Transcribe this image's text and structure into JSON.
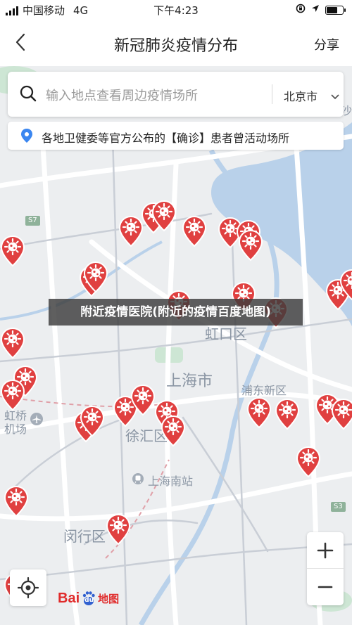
{
  "status_bar": {
    "carrier": "中国移动",
    "network": "4G",
    "time": "下午4:23",
    "battery_level": 0.7
  },
  "nav": {
    "title": "新冠肺炎疫情分布",
    "share_label": "分享"
  },
  "search": {
    "placeholder": "输入地点查看周边疫情场所",
    "city": "北京市"
  },
  "info": {
    "text": "各地卫健委等官方公布的【确诊】患者曾活动场所"
  },
  "map_labels": {
    "hongkou": "虹口区",
    "shanghai": "上海市",
    "pudong": "浦东新区",
    "xujiahui": "徐汇区",
    "minhang": "闵行区",
    "south_station": "上海南站",
    "hongqiao": "虹桥",
    "airport": "机场",
    "s7": "S7",
    "s3": "S3",
    "sha": "沙"
  },
  "caption": "附近疫情医院(附近的疫情百度地图)",
  "zoom": {
    "in": "+",
    "out": "−"
  },
  "logo": {
    "bai": "Bai",
    "du": "du",
    "map": "地图"
  },
  "icons": {
    "back": "chevron-left-icon",
    "search": "search-icon",
    "location": "location-pin-icon",
    "locate": "locate-icon",
    "pin": "virus-marker-icon"
  },
  "colors": {
    "pin": "#e04040",
    "water": "#b9d1ea",
    "park": "#cde6d4",
    "accent": "#3a86f0"
  }
}
